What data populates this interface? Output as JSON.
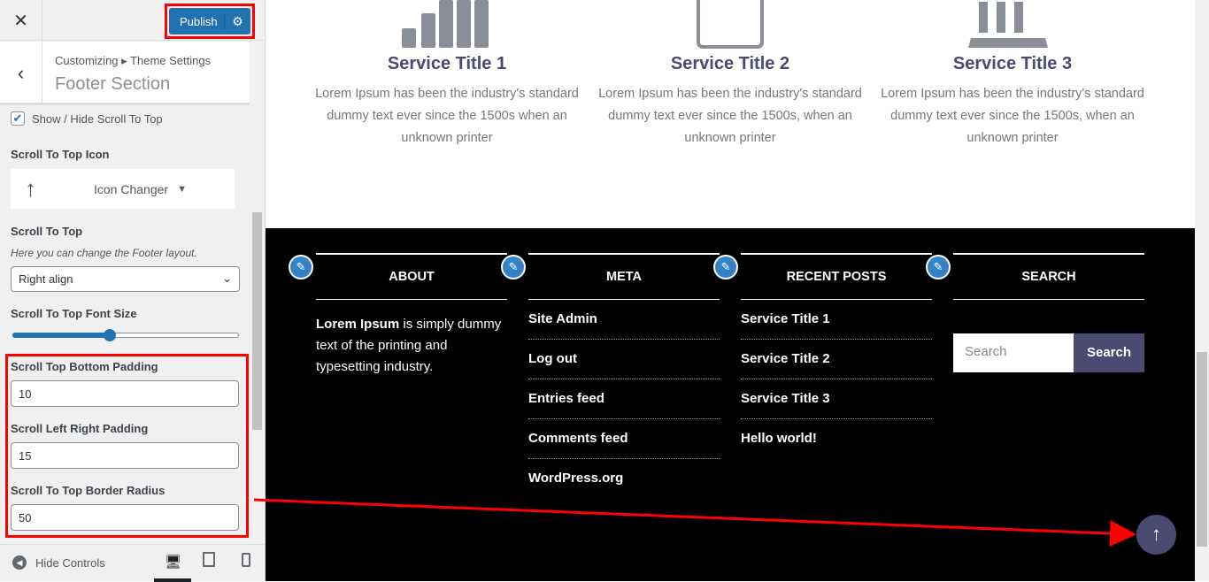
{
  "sidebar": {
    "close": "✕",
    "publish": "Publish",
    "back": "‹",
    "breadcrumb": "Customizing ▸ Theme Settings",
    "section_title": "Footer Section",
    "show_hide_label": "Show / Hide Scroll To Top",
    "show_hide_checked": true,
    "icon_label": "Scroll To Top Icon",
    "icon_changer": "Icon Changer",
    "icon_glyph": "🠉",
    "align_label": "Scroll To Top",
    "align_desc": "Here you can change the Footer layout.",
    "align_value": "Right align",
    "font_size_label": "Scroll To Top Font Size",
    "font_size_fraction": 0.43,
    "bottom_padding_label": "Scroll Top Bottom Padding",
    "bottom_padding": "10",
    "lr_padding_label": "Scroll Left Right Padding",
    "lr_padding": "15",
    "radius_label": "Scroll To Top Border Radius",
    "radius": "50",
    "hide_controls": "Hide Controls"
  },
  "services": [
    {
      "title": "Service Title 1",
      "text": "Lorem Ipsum has been the industry's standard dummy text ever since the 1500s when an unknown printer",
      "icon": "signal-bars-icon"
    },
    {
      "title": "Service Title 2",
      "text": "Lorem Ipsum has been the industry's standard dummy text ever since the 1500s, when an unknown printer",
      "icon": "tablet-icon"
    },
    {
      "title": "Service Title 3",
      "text": "Lorem Ipsum has been the industry's standard dummy text ever since the 1500s, when an unknown printer",
      "icon": "bank-icon"
    }
  ],
  "footer": {
    "about": {
      "title": "ABOUT",
      "bold": "Lorem Ipsum",
      "text": " is simply dummy text of the printing and typesetting industry."
    },
    "meta": {
      "title": "META",
      "items": [
        "Site Admin",
        "Log out",
        "Entries feed",
        "Comments feed",
        "WordPress.org"
      ]
    },
    "recent": {
      "title": "RECENT POSTS",
      "items": [
        "Service Title 1",
        "Service Title 2",
        "Service Title 3",
        "Hello world!"
      ]
    },
    "search": {
      "title": "SEARCH",
      "placeholder": "Search",
      "button": "Search"
    },
    "scroll_top_glyph": "↑"
  },
  "colors": {
    "accent": "#2271b1",
    "brand": "#4a4a73",
    "annotation": "#ff0000"
  }
}
